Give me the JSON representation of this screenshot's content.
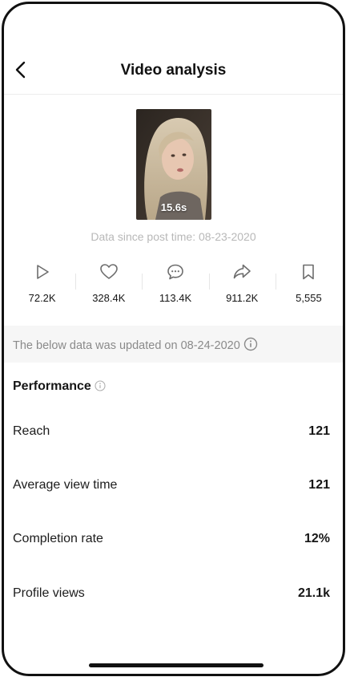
{
  "header": {
    "title": "Video analysis"
  },
  "video": {
    "duration": "15.6s"
  },
  "since_text": "Data since post time: 08-23-2020",
  "stats": [
    {
      "icon": "play-icon",
      "value": "72.2K"
    },
    {
      "icon": "heart-icon",
      "value": "328.4K"
    },
    {
      "icon": "comment-icon",
      "value": "113.4K"
    },
    {
      "icon": "share-icon",
      "value": "911.2K"
    },
    {
      "icon": "bookmark-icon",
      "value": "5,555"
    }
  ],
  "update_banner": {
    "text": "The below data was updated on 08-24-2020"
  },
  "performance": {
    "title": "Performance",
    "metrics": [
      {
        "label": "Reach",
        "value": "121"
      },
      {
        "label": "Average view time",
        "value": "121"
      },
      {
        "label": "Completion rate",
        "value": "12%"
      },
      {
        "label": "Profile views",
        "value": "21.1k"
      }
    ]
  }
}
